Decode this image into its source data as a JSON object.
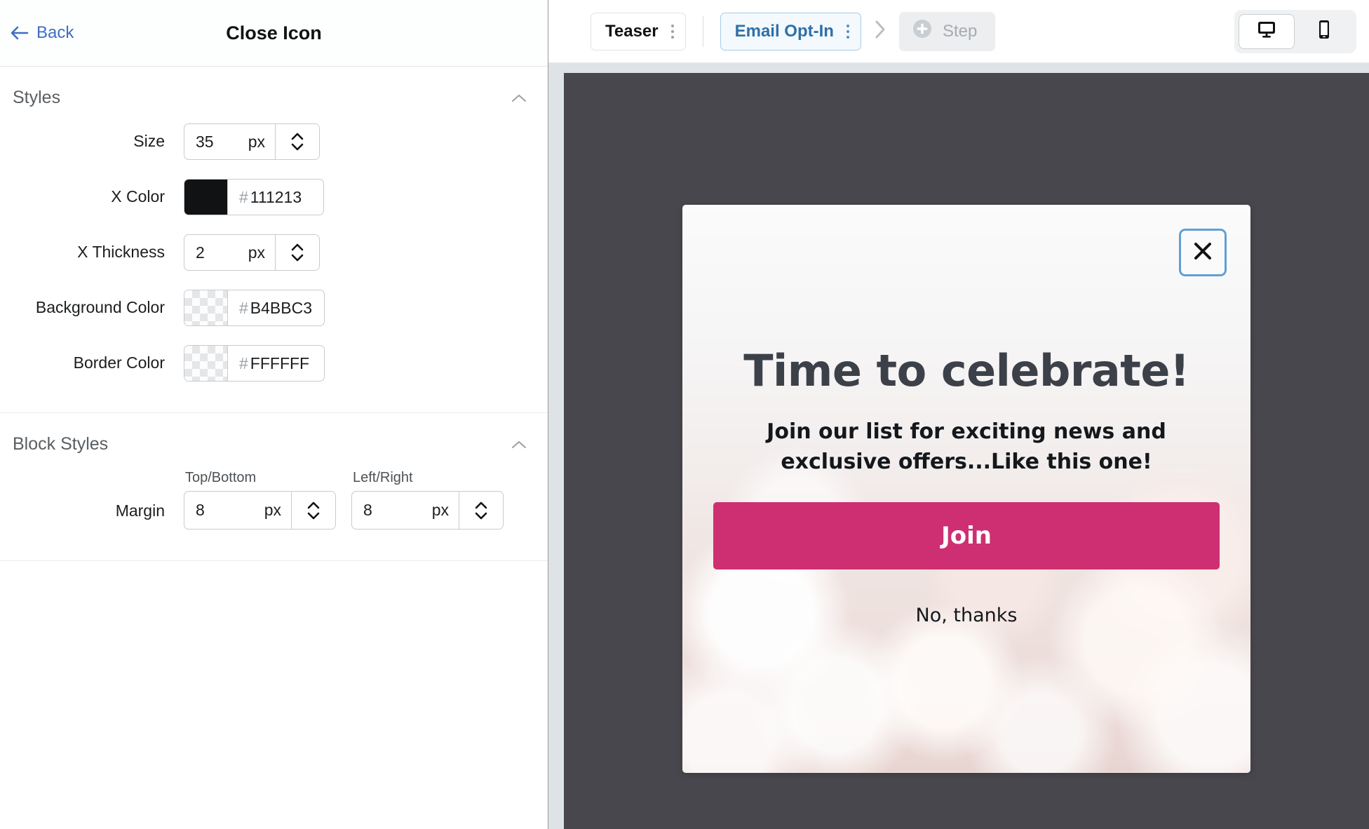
{
  "left_panel": {
    "back_label": "Back",
    "title": "Close Icon",
    "sections": [
      {
        "title": "Styles",
        "collapse_icon": "chevron-up-icon",
        "fields": [
          {
            "label": "Size",
            "type": "stepper",
            "value": "35",
            "unit": "px"
          },
          {
            "label": "X Color",
            "type": "color",
            "hash": "#",
            "value": "111213",
            "swatch": "solid",
            "swatch_color": "#111213"
          },
          {
            "label": "X Thickness",
            "type": "stepper",
            "value": "2",
            "unit": "px"
          },
          {
            "label": "Background Color",
            "type": "color",
            "hash": "#",
            "value": "B4BBC3",
            "swatch": "checker"
          },
          {
            "label": "Border Color",
            "type": "color",
            "hash": "#",
            "value": "FFFFFF",
            "swatch": "checker"
          }
        ]
      },
      {
        "title": "Block Styles",
        "collapse_icon": "chevron-up-icon",
        "margin": {
          "label": "Margin",
          "top_bottom": {
            "caption": "Top/Bottom",
            "value": "8",
            "unit": "px"
          },
          "left_right": {
            "caption": "Left/Right",
            "value": "8",
            "unit": "px"
          }
        }
      }
    ]
  },
  "topbar": {
    "teaser_chip": "Teaser",
    "optin_chip": "Email Opt-In",
    "step_button": "Step",
    "device_desktop_icon": "monitor-icon",
    "device_mobile_icon": "mobile-icon",
    "arrow_icon": "chevron-right-icon"
  },
  "preview": {
    "close_icon": "close-x-icon",
    "title": "Time to celebrate!",
    "subtitle": "Join our list for exciting news and exclusive offers...Like this one!",
    "cta_label": "Join",
    "dismiss_label": "No, thanks"
  },
  "colors": {
    "accent_pink": "#CD2F72",
    "canvas_dark": "#48474D",
    "canvas_light": "#DEE3E6",
    "link_blue": "#3D6FC4",
    "selected_blue": "#5FA0D4"
  }
}
